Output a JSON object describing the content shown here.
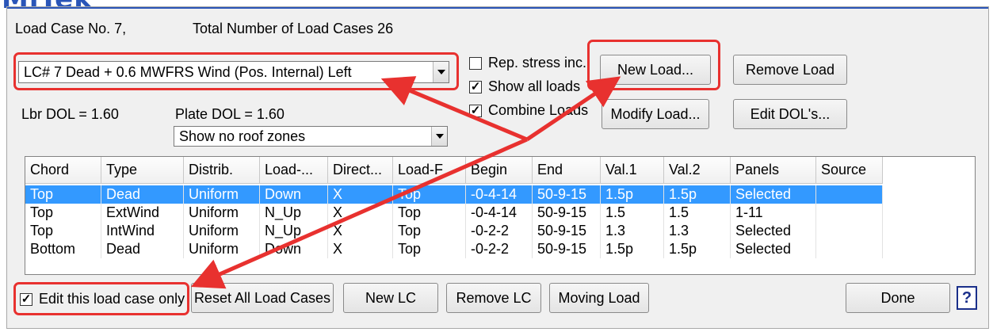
{
  "brand": {
    "title": "MiTek"
  },
  "header": {
    "load_case_no": "Load Case No.  7,",
    "total_cases": "Total Number of Load Cases  26"
  },
  "load_case_select": {
    "value": "LC# 7 Dead + 0.6 MWFRS Wind (Pos. Internal) Left"
  },
  "checkboxes": {
    "rep_stress": {
      "label": "Rep. stress inc.",
      "checked": false
    },
    "show_all": {
      "label": "Show all loads",
      "checked": true
    },
    "combine": {
      "label": "Combine Loads",
      "checked": true
    },
    "edit_only": {
      "label": "Edit this load case only",
      "checked": true
    }
  },
  "dol": {
    "lbr": "Lbr DOL =   1.60",
    "plate": "Plate DOL =   1.60"
  },
  "roof_zone_select": {
    "value": "Show no roof zones"
  },
  "buttons": {
    "new_load": "New Load...",
    "remove_load": "Remove Load",
    "modify_load": "Modify Load...",
    "edit_dols": "Edit DOL's...",
    "reset_all": "Reset All Load Cases",
    "new_lc": "New LC",
    "remove_lc": "Remove LC",
    "moving_load": "Moving Load",
    "done": "Done",
    "help": "?"
  },
  "table": {
    "columns": [
      "Chord",
      "Type",
      "Distrib.",
      "Load-...",
      "Direct...",
      "Load-F",
      "Begin",
      "End",
      "Val.1",
      "Val.2",
      "Panels",
      "Source"
    ],
    "rows": [
      [
        "Top",
        "Dead",
        "Uniform",
        "Down",
        "X",
        "Top",
        "-0-4-14",
        "50-9-15",
        "1.5p",
        "1.5p",
        "Selected",
        ""
      ],
      [
        "Top",
        "ExtWind",
        "Uniform",
        "N_Up",
        "X",
        "Top",
        "-0-4-14",
        "50-9-15",
        "1.5",
        "1.5",
        " 1-11",
        ""
      ],
      [
        "Top",
        "IntWind",
        "Uniform",
        "N_Up",
        "X",
        "Top",
        "-0-2-2",
        "50-9-15",
        "1.3",
        "1.3",
        "Selected",
        ""
      ],
      [
        "Bottom",
        "Dead",
        "Uniform",
        "Down",
        "X",
        "Top",
        "-0-2-2",
        "50-9-15",
        "1.5p",
        "1.5p",
        "Selected",
        ""
      ]
    ],
    "selected_row": 0
  },
  "colors": {
    "highlight": "#e8312f",
    "selection": "#3399ff",
    "brand": "#2a55b8"
  }
}
